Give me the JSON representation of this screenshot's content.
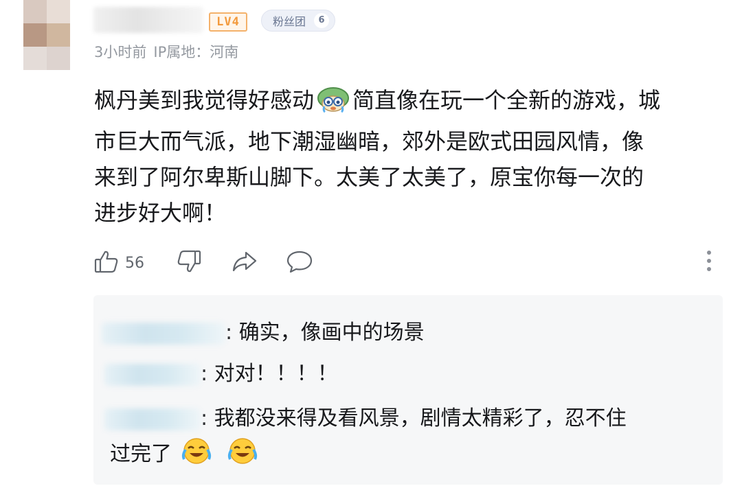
{
  "user": {
    "level": "LV4",
    "fan_badge": {
      "label": "粉丝团",
      "count": "6"
    },
    "time": "3小时前",
    "ip_location": "IP属地：河南"
  },
  "comment": {
    "lines": [
      "枫丹美到我觉得好感动",
      "简直像在玩一个全新的游戏，城",
      "市巨大而气派，地下潮湿幽暗，郊外是欧式田园风情，像",
      "来到了阿尔卑斯山脚下。太美了太美了，原宝你每一次的",
      "进步好大啊！"
    ],
    "inline_emoji": "crying-doll-emoji"
  },
  "actions": {
    "like_count": "56",
    "icons": [
      "thumbs-up-icon",
      "thumbs-down-icon",
      "share-icon",
      "comment-icon",
      "more-icon"
    ]
  },
  "replies": [
    {
      "text": ": 确实，像画中的场景"
    },
    {
      "text": ": 对对！！！！"
    },
    {
      "text_line1": ": 我都没来得及看风景，剧情太精彩了，忍不住",
      "text_line2": "过完了",
      "emojis": [
        "crying-laughing-emoji",
        "crying-laughing-emoji"
      ]
    }
  ],
  "colors": {
    "text": "#18191c",
    "meta": "#9499a0",
    "level": "#f39a3d",
    "reply_bg": "#f6f7f8"
  }
}
